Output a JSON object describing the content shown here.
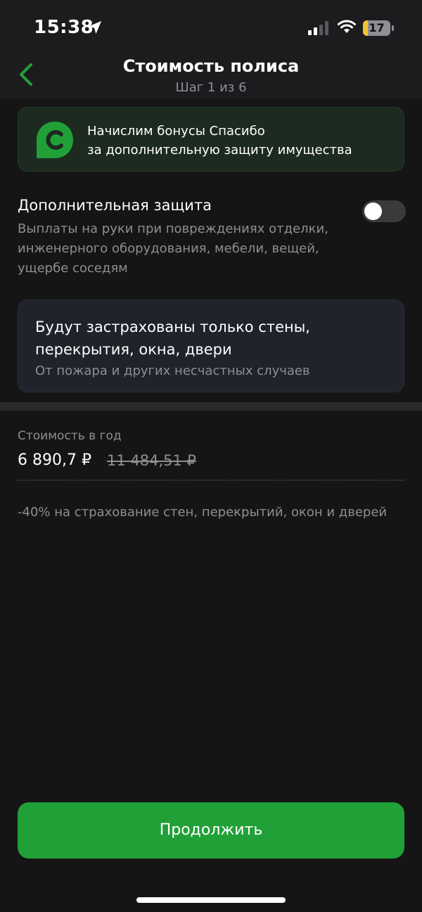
{
  "status_bar": {
    "time": "15:38",
    "battery_level": "17",
    "battery_percent": 17,
    "battery_color": "#f4c430"
  },
  "header": {
    "title": "Стоимость полиса",
    "step": "Шаг 1 из 6",
    "back_icon": "chevron-left-icon",
    "accent_color": "#21a038"
  },
  "bonus_banner": {
    "logo_letter": "С",
    "line1": "Начислим бонусы Спасибо",
    "line2": "за дополнительную защиту имущества"
  },
  "additional_protection": {
    "title": "Дополнительная защита",
    "description": "Выплаты на руки при повреждениях отделки, инженерного оборудования, мебели, вещей, ущербе соседям",
    "enabled": false
  },
  "info_card": {
    "title": "Будут застрахованы только стены, перекрытия, окна, двери",
    "subtitle": "От пожара и других несчастных случаев"
  },
  "price": {
    "label": "Стоимость в год",
    "current": "6 890,7 ₽",
    "old": "11 484,51 ₽",
    "discount_note": "-40% на страхование стен, перекрытий, окон и дверей"
  },
  "actions": {
    "continue_label": "Продолжить",
    "button_color": "#21a038"
  }
}
